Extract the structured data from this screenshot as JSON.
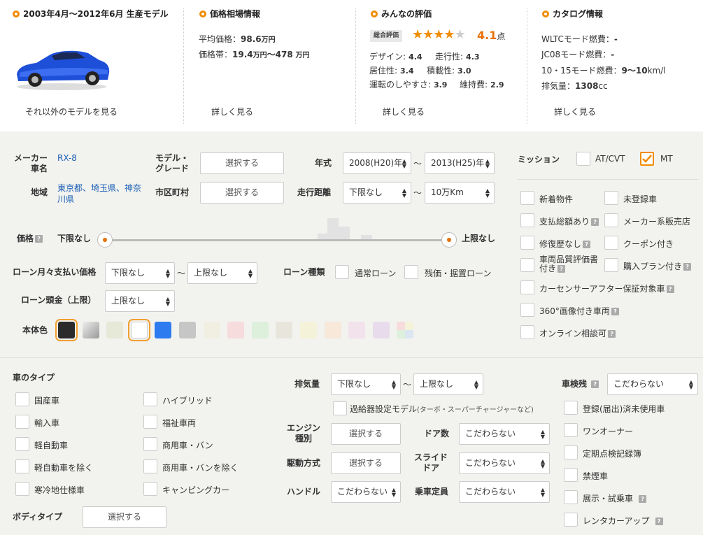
{
  "model_period": {
    "title": "2003年4月～2012年6月 生産モデル",
    "other_models_link": "それ以外のモデルを見る"
  },
  "price_info": {
    "title": "価格相場情報",
    "avg_label": "平均価格：",
    "avg_value": "98.6",
    "avg_unit": "万円",
    "range_label": "価格帯：",
    "range_min": "19.4",
    "range_min_unit": "万円",
    "range_sep": "～",
    "range_max": "478",
    "range_max_unit": "万円",
    "details_link": "詳しく見る"
  },
  "reviews": {
    "title": "みんなの評価",
    "overall_badge": "総合評価",
    "overall_score": "4.1",
    "overall_unit": "点",
    "stars_filled": 4,
    "stars_total": 5,
    "items": [
      {
        "label": "デザイン",
        "value": "4.4"
      },
      {
        "label": "走行性",
        "value": "4.3"
      },
      {
        "label": "居住性",
        "value": "3.4"
      },
      {
        "label": "積載性",
        "value": "3.0"
      },
      {
        "label": "運転のしやすさ",
        "value": "3.9"
      },
      {
        "label": "維持費",
        "value": "2.9"
      }
    ],
    "details_link": "詳しく見る"
  },
  "catalog": {
    "title": "カタログ情報",
    "wltc_label": "WLTCモード燃費：",
    "wltc_value": "-",
    "jc08_label": "JC08モード燃費：",
    "jc08_value": "-",
    "mode1015_label": "10・15モード燃費：",
    "mode1015_value": "9～10",
    "mode1015_unit": "km/l",
    "displacement_label": "排気量：",
    "displacement_value": "1308",
    "displacement_unit": "cc",
    "details_link": "詳しく見る"
  },
  "search": {
    "maker_label": "メーカー\n車名",
    "maker_value": "RX-8",
    "region_label": "地域",
    "region_value": "東京都、埼玉県、神奈川県",
    "model_grade_label": "モデル・\nグレード",
    "model_grade_btn": "選択する",
    "city_label": "市区町村",
    "city_btn": "選択する",
    "year_label": "年式",
    "year_from": "2008(H20)年",
    "year_to": "2013(H25)年",
    "tilde": "～",
    "mileage_label": "走行距離",
    "mileage_from": "下限なし",
    "mileage_to": "10万Km",
    "mission_label": "ミッション",
    "mission_options": [
      {
        "label": "AT/CVT",
        "checked": false
      },
      {
        "label": "MT",
        "checked": true
      }
    ],
    "price_label": "価格",
    "price_min": "下限なし",
    "price_max": "上限なし",
    "loan_monthly_label": "ローン月々支払い価格",
    "loan_monthly_from": "下限なし",
    "loan_monthly_to": "上限なし",
    "loan_type_label": "ローン種類",
    "loan_type_options": [
      "通常ローン",
      "残価・据置ローン"
    ],
    "loan_down_label": "ローン頭金（上限）",
    "loan_down_value": "上限なし",
    "body_color_label": "本体色",
    "body_colors": [
      "#2b2b2b",
      "#b5b5b5",
      "#e6e8d8",
      "#ffffff",
      "#2e7bf0",
      "#c6c6c6",
      "#f1efe2",
      "#f6dcdc",
      "#dcf0dc",
      "#e8e5dc",
      "#f4f2d8",
      "#f7e8da",
      "#f2e2ec",
      "#e8dcec",
      "multi"
    ],
    "options": [
      {
        "label": "新着物件",
        "help": false
      },
      {
        "label": "未登録車",
        "help": false
      },
      {
        "label": "支払総額あり",
        "help": true
      },
      {
        "label": "メーカー系販売店",
        "help": false
      },
      {
        "label": "修復歴なし",
        "help": true
      },
      {
        "label": "クーポン付き",
        "help": false
      },
      {
        "label": "車両品質評価書付き",
        "help": true
      },
      {
        "label": "購入プラン付き",
        "help": true
      },
      {
        "label": "カーセンサーアフター保証対象車",
        "help": true
      },
      {
        "label": "360°画像付き車両",
        "help": true
      },
      {
        "label": "オンライン相談可",
        "help": true
      }
    ]
  },
  "lower": {
    "car_type_label": "車のタイプ",
    "car_types": [
      "国産車",
      "ハイブリッド",
      "輸入車",
      "福祉車両",
      "軽自動車",
      "商用車・バン",
      "軽自動車を除く",
      "商用車・バンを除く",
      "寒冷地仕様車",
      "キャンピングカー"
    ],
    "body_type_label": "ボディタイプ",
    "body_type_btn": "選択する",
    "displacement_label": "排気量",
    "displacement_from": "下限なし",
    "displacement_to": "上限なし",
    "supercharger_label": "過給器設定モデル",
    "supercharger_note": "(ターボ・スーパーチャージャーなど)",
    "engine_label": "エンジン\n種別",
    "engine_btn": "選択する",
    "drive_label": "駆動方式",
    "drive_btn": "選択する",
    "handle_label": "ハンドル",
    "handle_value": "こだわらない",
    "door_label": "ドア数",
    "door_value": "こだわらない",
    "slide_label": "スライド\nドア",
    "slide_value": "こだわらない",
    "capacity_label": "乗車定員",
    "capacity_value": "こだわらない",
    "inspection_label": "車検残",
    "inspection_value": "こだわらない",
    "right_options": [
      {
        "label": "登録(届出)済未使用車",
        "help": false
      },
      {
        "label": "ワンオーナー",
        "help": false
      },
      {
        "label": "定期点検記録簿",
        "help": false
      },
      {
        "label": "禁煙車",
        "help": false
      },
      {
        "label": "展示・試乗車",
        "help": true
      },
      {
        "label": "レンタカーアップ",
        "help": true
      }
    ]
  },
  "colors": {
    "accent": "#f08c00",
    "link": "#1a5fb4",
    "star": "#f08c00",
    "score": "#e8710a"
  }
}
